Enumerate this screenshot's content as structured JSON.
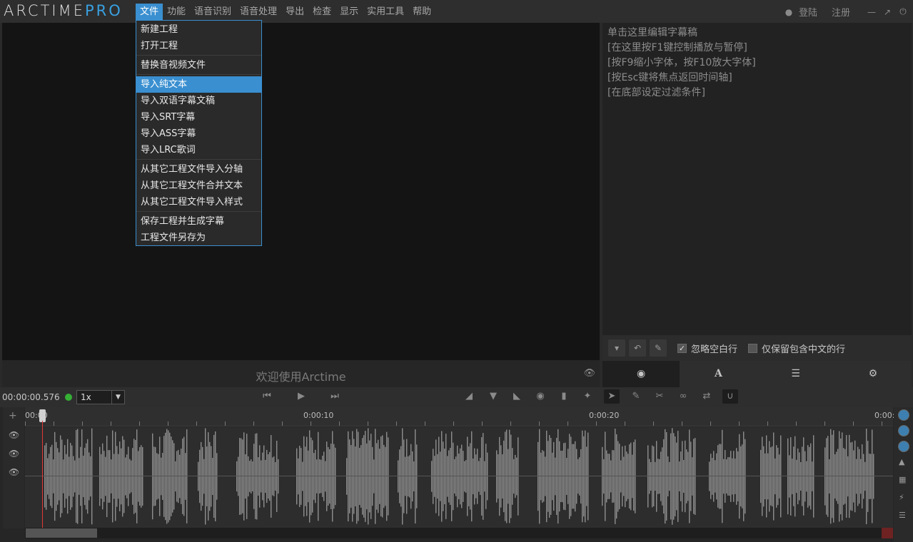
{
  "logo": {
    "main": "ARCTIME",
    "pro": "PRO"
  },
  "menubar": {
    "items": [
      "文件",
      "功能",
      "语音识别",
      "语音处理",
      "导出",
      "检查",
      "显示",
      "实用工具",
      "帮助"
    ]
  },
  "account": {
    "login": "登陆",
    "register": "注册"
  },
  "file_menu": {
    "groups": [
      [
        "新建工程",
        "打开工程"
      ],
      [
        "替换音视频文件"
      ],
      [
        "导入纯文本",
        "导入双语字幕文稿",
        "导入SRT字幕",
        "导入ASS字幕",
        "导入LRC歌词"
      ],
      [
        "从其它工程文件导入分轴",
        "从其它工程文件合并文本",
        "从其它工程文件导入样式"
      ],
      [
        "保存工程并生成字幕",
        "工程文件另存为"
      ]
    ],
    "highlighted": "导入纯文本"
  },
  "welcome": "欢迎使用Arctime",
  "editor": {
    "lines": [
      "单击这里编辑字幕稿",
      "[在这里按F1键控制播放与暂停]",
      "[按F9缩小字体，按F10放大字体]",
      "[按Esc键将焦点返回时间轴]",
      "[在底部设定过滤条件]"
    ]
  },
  "filters": {
    "ignore_blank": "忽略空白行",
    "ignore_blank_checked": true,
    "keep_chinese": "仅保留包含中文的行",
    "keep_chinese_checked": false
  },
  "transport": {
    "timecode": "00:00:00.576",
    "speed": "1x"
  },
  "ruler": {
    "labels": [
      "00:00",
      "0:00:10",
      "0:00:20",
      "0:00:"
    ]
  },
  "colors": {
    "accent": "#3a8fd0",
    "playhead": "#e03a3a",
    "status_dot": "#35b035"
  }
}
